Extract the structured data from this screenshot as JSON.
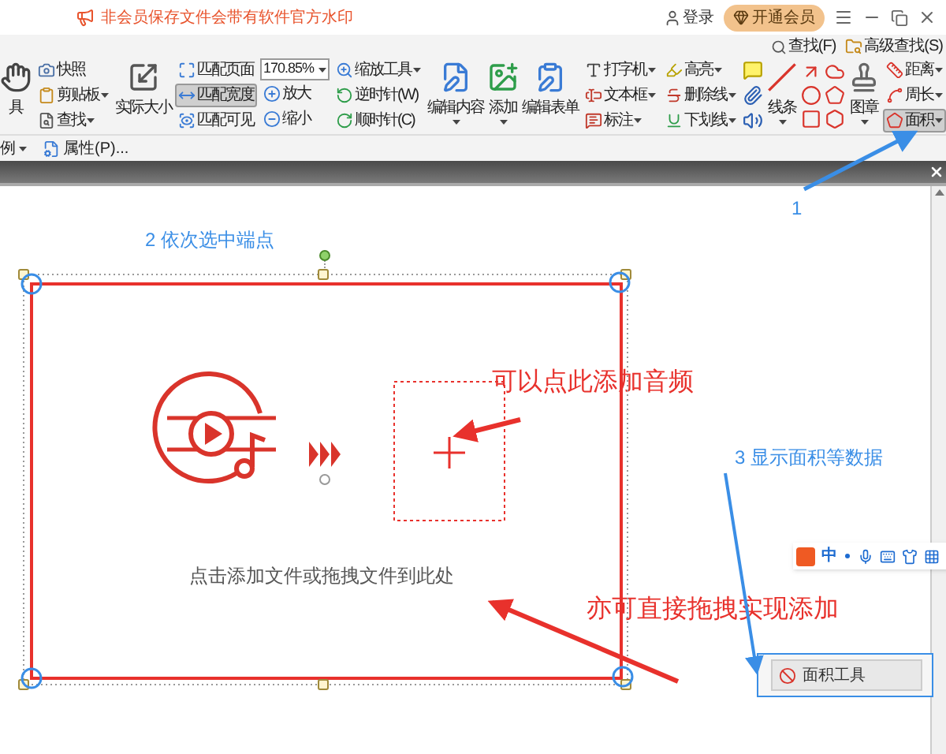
{
  "notice": "非会员保存文件会带有软件官方水印",
  "header": {
    "login": "登录",
    "vip": "开通会员"
  },
  "find_links": [
    "查找(F)",
    "高级查找(S)"
  ],
  "ribbon": [
    {
      "kind": "large",
      "label": "具",
      "dropdown": false
    },
    {
      "kind": "stack",
      "items": [
        {
          "label": "快照",
          "dropdown": false,
          "selected": false
        },
        {
          "label": "剪贴板",
          "dropdown": true,
          "selected": false
        },
        {
          "label": "查找",
          "dropdown": true,
          "selected": false
        }
      ]
    },
    {
      "kind": "large",
      "label": "实际大小",
      "dropdown": false
    },
    {
      "kind": "stack",
      "items": [
        {
          "label": "匹配页面",
          "dropdown": false,
          "selected": false
        },
        {
          "label": "匹配宽度",
          "dropdown": false,
          "selected": true
        },
        {
          "label": "匹配可见",
          "dropdown": false,
          "selected": false
        }
      ]
    },
    {
      "kind": "zoom",
      "value": "170.85%",
      "items": [
        {
          "label": "放大",
          "dropdown": false,
          "selected": false
        },
        {
          "label": "缩小",
          "dropdown": false,
          "selected": false
        }
      ]
    },
    {
      "kind": "stack",
      "items": [
        {
          "label": "缩放工具",
          "dropdown": true,
          "selected": false
        },
        {
          "label": "逆时针(W)",
          "dropdown": false,
          "selected": false
        },
        {
          "label": "顺时针(C)",
          "dropdown": false,
          "selected": false
        }
      ]
    },
    {
      "kind": "large",
      "label": "编辑内容",
      "dropdown": true
    },
    {
      "kind": "large",
      "label": "添加",
      "dropdown": true
    },
    {
      "kind": "large",
      "label": "编辑表单",
      "dropdown": false
    },
    {
      "kind": "stack",
      "items": [
        {
          "label": "打字机",
          "dropdown": true,
          "selected": false
        },
        {
          "label": "文本框",
          "dropdown": true,
          "selected": false
        },
        {
          "label": "标注",
          "dropdown": true,
          "selected": false
        }
      ]
    },
    {
      "kind": "stack",
      "items": [
        {
          "label": "高亮",
          "dropdown": true,
          "selected": false
        },
        {
          "label": "删除线",
          "dropdown": true,
          "selected": false
        },
        {
          "label": "下划线",
          "dropdown": true,
          "selected": false
        }
      ]
    },
    {
      "kind": "icons"
    },
    {
      "kind": "large",
      "label": "线条",
      "dropdown": true
    },
    {
      "kind": "shapes"
    },
    {
      "kind": "large",
      "label": "图章",
      "dropdown": true
    },
    {
      "kind": "stack",
      "items": [
        {
          "label": "距离",
          "dropdown": true,
          "selected": false
        },
        {
          "label": "周长",
          "dropdown": true,
          "selected": false
        },
        {
          "label": "面积",
          "dropdown": true,
          "selected": true
        }
      ]
    }
  ],
  "bottom_row": [
    {
      "label": "例",
      "dropdown": true
    },
    {
      "label": "属性(P)...",
      "dropdown": false
    }
  ],
  "annotations": [
    {
      "text": "1",
      "color": "#3a8ee6"
    },
    {
      "text": "2 依次选中端点",
      "color": "#3a8ee6"
    },
    {
      "text": "可以点此添加音频",
      "color": "#e8312c"
    },
    {
      "text": "3 显示面积等数据",
      "color": "#3a8ee6"
    },
    {
      "text": "亦可直接拖拽实现添加",
      "color": "#e8312c"
    }
  ],
  "drop_hint": "点击添加文件或拖拽文件到此处",
  "ime_mode": "中",
  "panel": {
    "title": "面积工具"
  }
}
